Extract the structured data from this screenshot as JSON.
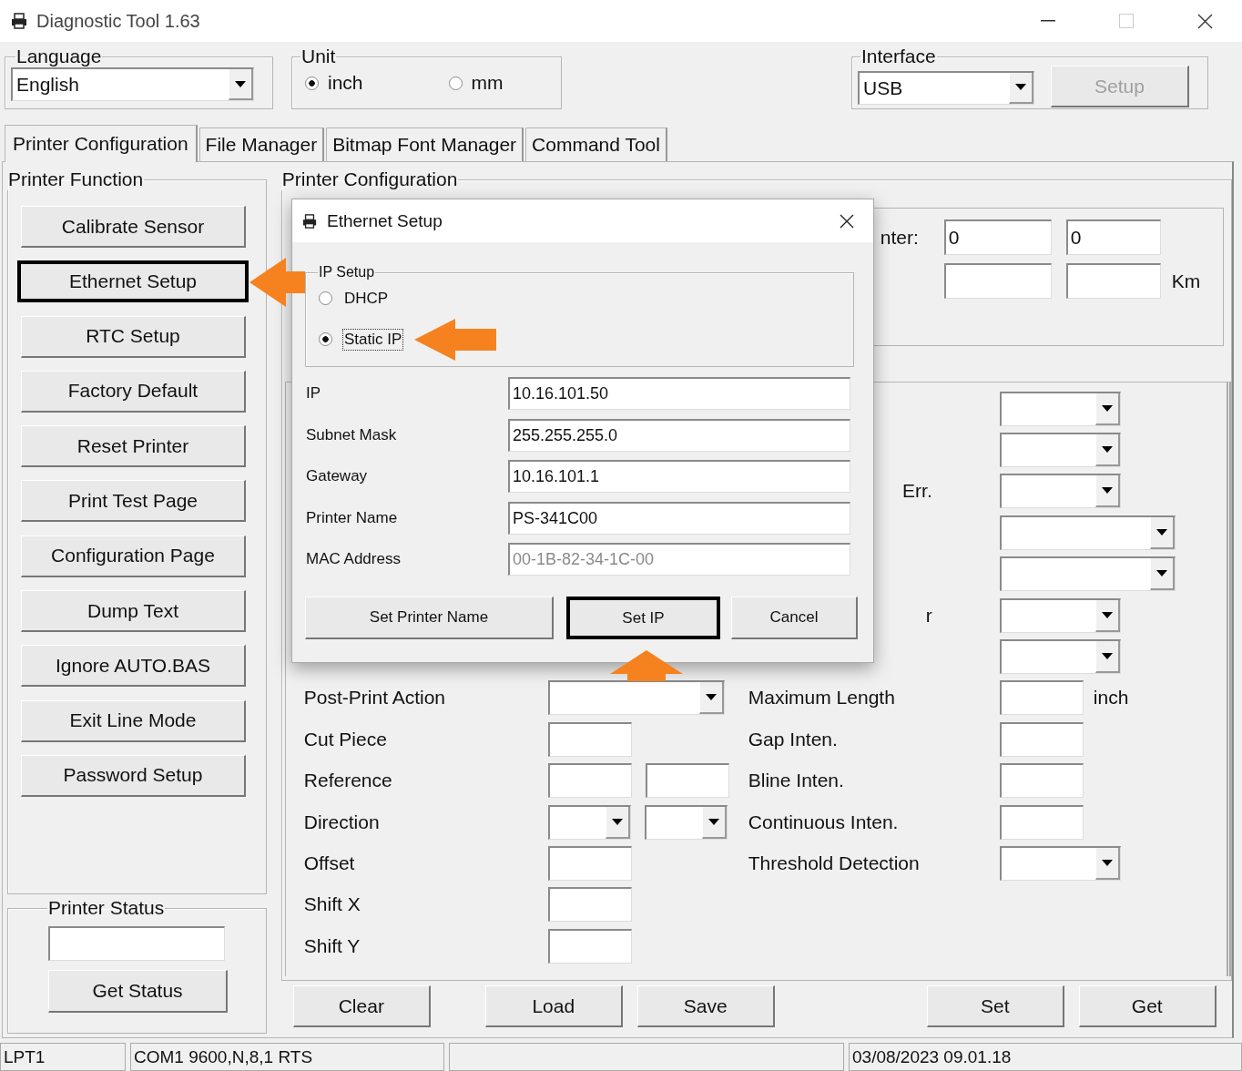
{
  "window": {
    "title": "Diagnostic Tool 1.63"
  },
  "language": {
    "label": "Language",
    "value": "English"
  },
  "unit": {
    "label": "Unit",
    "options": [
      {
        "label": "inch",
        "selected": true
      },
      {
        "label": "mm",
        "selected": false
      }
    ]
  },
  "interface": {
    "label": "Interface",
    "value": "USB",
    "setup_button": {
      "label": "Setup",
      "disabled": true
    }
  },
  "tabs": [
    {
      "label": "Printer Configuration",
      "selected": true
    },
    {
      "label": "File Manager",
      "selected": false
    },
    {
      "label": "Bitmap Font Manager",
      "selected": false
    },
    {
      "label": "Command Tool",
      "selected": false
    }
  ],
  "printer_function": {
    "label": "Printer Function",
    "buttons": [
      {
        "label": "Calibrate Sensor",
        "highlighted": false
      },
      {
        "label": "Ethernet Setup",
        "highlighted": true
      },
      {
        "label": "RTC Setup",
        "highlighted": false
      },
      {
        "label": "Factory Default",
        "highlighted": false
      },
      {
        "label": "Reset Printer",
        "highlighted": false
      },
      {
        "label": "Print Test Page",
        "highlighted": false
      },
      {
        "label": "Configuration Page",
        "highlighted": false
      },
      {
        "label": "Dump Text",
        "highlighted": false
      },
      {
        "label": "Ignore AUTO.BAS",
        "highlighted": false
      },
      {
        "label": "Exit Line Mode",
        "highlighted": false
      },
      {
        "label": "Password Setup",
        "highlighted": false
      }
    ]
  },
  "printer_status": {
    "label": "Printer Status",
    "button": "Get Status"
  },
  "printer_configuration": {
    "label": "Printer Configuration",
    "top_group": {
      "label": "nter:",
      "first_row": [
        "0",
        "0"
      ],
      "second_row_unit": "Km"
    },
    "left_rows": [
      {
        "label": "Post-Print Action",
        "kind": "wide_combo"
      },
      {
        "label": "Cut Piece",
        "kind": "field"
      },
      {
        "label": "Reference",
        "kind": "two_fields"
      },
      {
        "label": "Direction",
        "kind": "two_combos"
      },
      {
        "label": "Offset",
        "kind": "field"
      },
      {
        "label": "Shift X",
        "kind": "field"
      },
      {
        "label": "Shift Y",
        "kind": "field"
      }
    ],
    "right_rows": [
      {
        "kind": "combo"
      },
      {
        "kind": "combo"
      },
      {
        "label": "Err.",
        "clipped": true,
        "kind": "combo"
      },
      {
        "kind": "wide_combo"
      },
      {
        "kind": "wide_combo"
      },
      {
        "label": "r",
        "clipped": true,
        "kind": "combo"
      },
      {
        "kind": "combo"
      },
      {
        "label": "Maximum Length",
        "clipped": false,
        "kind": "field",
        "unit": "inch"
      },
      {
        "label": "Gap Inten.",
        "clipped": false,
        "kind": "field"
      },
      {
        "label": "Bline Inten.",
        "clipped": false,
        "kind": "field"
      },
      {
        "label": "Continuous Inten.",
        "clipped": false,
        "kind": "field"
      },
      {
        "label": "Threshold Detection",
        "clipped": false,
        "kind": "combo"
      }
    ]
  },
  "bottom_buttons": [
    "Clear",
    "Load",
    "Save",
    "Set",
    "Get"
  ],
  "status_bar": {
    "port": "LPT1",
    "serial": "COM1 9600,N,8,1 RTS",
    "time": "03/08/2023 09.01.18"
  },
  "dialog": {
    "title": "Ethernet Setup",
    "ip_setup": {
      "label": "IP Setup",
      "options": [
        {
          "label": "DHCP",
          "selected": false
        },
        {
          "label": "Static IP",
          "selected": true
        }
      ]
    },
    "fields": [
      {
        "label": "IP",
        "value": "10.16.101.50",
        "disabled": false
      },
      {
        "label": "Subnet Mask",
        "value": "255.255.255.0",
        "disabled": false
      },
      {
        "label": "Gateway",
        "value": "10.16.101.1",
        "disabled": false
      },
      {
        "label": "Printer Name",
        "value": "PS-341C00",
        "disabled": false
      },
      {
        "label": "MAC Address",
        "value": "00-1B-82-34-1C-00",
        "disabled": true
      }
    ],
    "buttons": [
      {
        "label": "Set Printer Name",
        "highlighted": false
      },
      {
        "label": "Set IP",
        "highlighted": true
      },
      {
        "label": "Cancel",
        "highlighted": false
      }
    ]
  }
}
